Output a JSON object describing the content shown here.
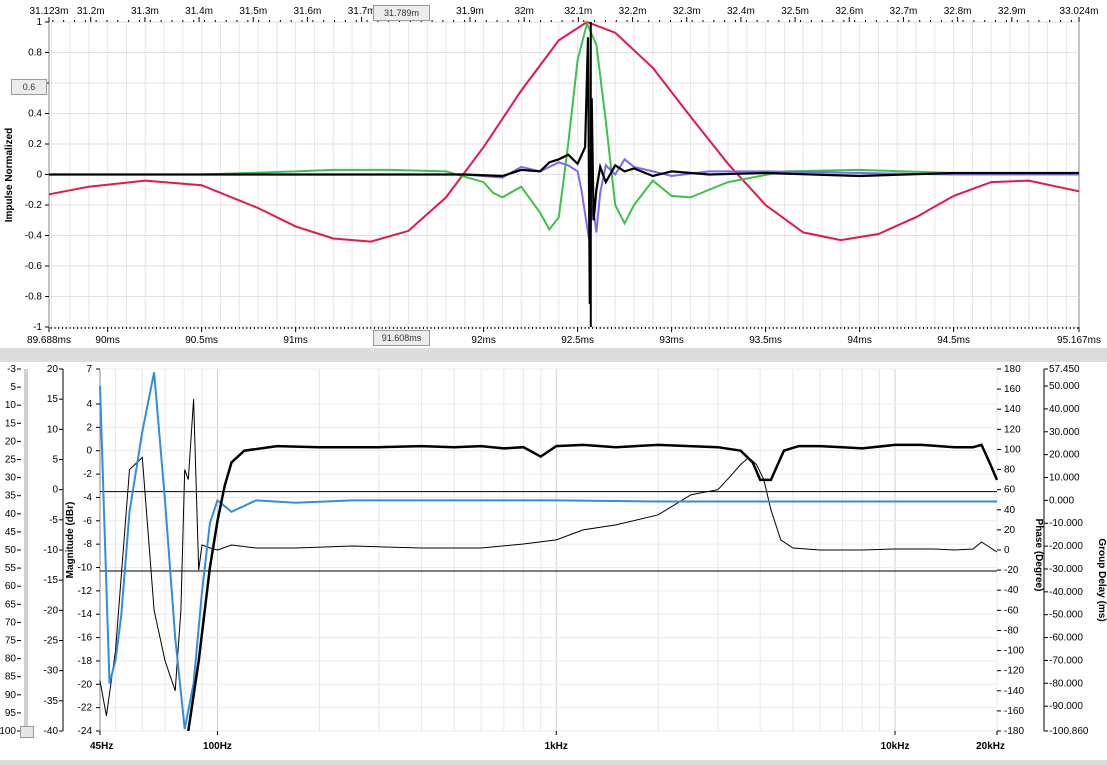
{
  "chart_data": [
    {
      "type": "line",
      "ylabel": "Impulse Normalized",
      "top_axis_ticks": [
        "31.123m",
        "31.2m",
        "31.3m",
        "31.4m",
        "31.5m",
        "31.6m",
        "31.7m",
        "31.9m",
        "32m",
        "32.1m",
        "32.2m",
        "32.3m",
        "32.4m",
        "32.5m",
        "32.6m",
        "32.7m",
        "32.8m",
        "32.9m",
        "33.024m"
      ],
      "top_axis_values": [
        31.123,
        31.2,
        31.3,
        31.4,
        31.5,
        31.6,
        31.7,
        31.9,
        32.0,
        32.1,
        32.2,
        32.3,
        32.4,
        32.5,
        32.6,
        32.7,
        32.8,
        32.9,
        33.024
      ],
      "bottom_axis_ticks": [
        "89.688ms",
        "90ms",
        "90.5ms",
        "91ms",
        "92ms",
        "92.5ms",
        "93ms",
        "93.5ms",
        "94ms",
        "94.5ms",
        "95.167ms"
      ],
      "bottom_axis_values": [
        89.688,
        90.0,
        90.5,
        91.0,
        92.0,
        92.5,
        93.0,
        93.5,
        94.0,
        94.5,
        95.167
      ],
      "y_ticks": [
        "1",
        "0.8",
        "0.6",
        "0.4",
        "0.2",
        "0",
        "-0.2",
        "-0.4",
        "-0.6",
        "-0.8",
        "-1"
      ],
      "y_tick_values": [
        1,
        0.8,
        0.6,
        0.4,
        0.2,
        0,
        -0.2,
        -0.4,
        -0.6,
        -0.8,
        -1
      ],
      "xlim": [
        89.688,
        95.167
      ],
      "ylim": [
        -1,
        1
      ],
      "grid": true,
      "cursor_top_label": "31.789m",
      "cursor_bottom_label": "91.608ms",
      "cursor_y_label": "0.6",
      "impulse_peak_x": 92.57,
      "series": [
        {
          "color": "#e8164a",
          "x": [
            89.688,
            89.9,
            90.2,
            90.5,
            90.8,
            91.0,
            91.2,
            91.4,
            91.6,
            91.8,
            92.0,
            92.2,
            92.4,
            92.55,
            92.7,
            92.9,
            93.1,
            93.3,
            93.5,
            93.7,
            93.9,
            94.1,
            94.3,
            94.5,
            94.7,
            94.9,
            95.167
          ],
          "values": [
            -0.13,
            -0.08,
            -0.04,
            -0.07,
            -0.22,
            -0.34,
            -0.42,
            -0.44,
            -0.37,
            -0.15,
            0.18,
            0.55,
            0.88,
            1.0,
            0.93,
            0.7,
            0.38,
            0.07,
            -0.2,
            -0.38,
            -0.43,
            -0.39,
            -0.28,
            -0.14,
            -0.05,
            -0.04,
            -0.11
          ]
        },
        {
          "color": "#3ec24a",
          "x": [
            89.688,
            90.5,
            91.0,
            91.2,
            91.5,
            91.8,
            92.0,
            92.05,
            92.1,
            92.2,
            92.3,
            92.35,
            92.4,
            92.45,
            92.5,
            92.55,
            92.6,
            92.65,
            92.7,
            92.75,
            92.8,
            92.9,
            93.0,
            93.1,
            93.3,
            93.6,
            94.0,
            94.5,
            95.167
          ],
          "values": [
            0.0,
            0.0,
            0.02,
            0.03,
            0.03,
            0.02,
            -0.05,
            -0.12,
            -0.15,
            -0.08,
            -0.25,
            -0.36,
            -0.28,
            0.2,
            0.75,
            0.99,
            0.85,
            0.35,
            -0.2,
            -0.32,
            -0.2,
            -0.04,
            -0.14,
            -0.15,
            -0.05,
            0.02,
            0.03,
            0.01,
            0.0
          ]
        },
        {
          "color": "#7a6cf0",
          "x": [
            89.688,
            90.5,
            91.0,
            91.5,
            91.9,
            92.1,
            92.2,
            92.3,
            92.4,
            92.45,
            92.5,
            92.52,
            92.56,
            92.58,
            92.6,
            92.62,
            92.65,
            92.7,
            92.75,
            92.8,
            92.9,
            93.0,
            93.2,
            93.5,
            94.0,
            94.5,
            95.167
          ],
          "values": [
            0.0,
            0.0,
            0.0,
            0.0,
            0.0,
            -0.02,
            0.05,
            0.02,
            0.08,
            0.06,
            0.02,
            -0.1,
            -0.42,
            -0.2,
            -0.38,
            -0.12,
            0.06,
            0.0,
            0.1,
            0.05,
            0.02,
            -0.01,
            0.02,
            0.02,
            0.01,
            0.0,
            0.0
          ]
        },
        {
          "color": "#000000",
          "x": [
            89.688,
            90.5,
            91.0,
            91.5,
            91.9,
            92.1,
            92.2,
            92.3,
            92.35,
            92.4,
            92.45,
            92.5,
            92.54,
            92.555,
            92.565,
            92.575,
            92.585,
            92.6,
            92.62,
            92.65,
            92.7,
            92.75,
            92.8,
            92.9,
            93.0,
            93.2,
            93.5,
            94.0,
            94.5,
            95.167
          ],
          "values": [
            0.0,
            0.0,
            0.0,
            0.0,
            0.0,
            -0.01,
            0.03,
            0.02,
            0.08,
            0.1,
            0.13,
            0.07,
            0.18,
            0.9,
            -0.85,
            0.5,
            -0.3,
            -0.1,
            0.05,
            -0.05,
            0.06,
            0.02,
            0.04,
            -0.01,
            0.02,
            0.0,
            0.01,
            -0.01,
            0.01,
            0.01
          ]
        }
      ]
    },
    {
      "type": "line",
      "xlabel": "",
      "x_scale": "log",
      "ylabel": "Magnitude (dBr)",
      "ylabel_right": "Phase (Degree)",
      "ylabel_right2": "Group Delay (ms)",
      "x_ticks": [
        "45Hz",
        "100Hz",
        "1kHz",
        "10kHz",
        "20kHz"
      ],
      "x_tick_values": [
        45,
        100,
        1000,
        10000,
        20000
      ],
      "xlim": [
        45,
        20000
      ],
      "mag_ticks": [
        "7",
        "4",
        "2",
        "0",
        "-2",
        "-4",
        "-6",
        "-8",
        "-10",
        "-12",
        "-14",
        "-16",
        "-18",
        "-20",
        "-22",
        "-24"
      ],
      "mag_tick_values": [
        7,
        4,
        2,
        0,
        -2,
        -4,
        -6,
        -8,
        -10,
        -12,
        -14,
        -16,
        -18,
        -20,
        -22,
        -24
      ],
      "mag_ylim": [
        -24,
        7
      ],
      "outer_left_ticks": [
        "-3",
        "5",
        "10",
        "15",
        "20",
        "25",
        "30",
        "35",
        "40",
        "45",
        "50",
        "55",
        "60",
        "65",
        "70",
        "75",
        "80",
        "85",
        "90",
        "95",
        "100"
      ],
      "inner_left_ticks": [
        "20",
        "15",
        "10",
        "5",
        "0",
        "-5",
        "-10",
        "-15",
        "-20",
        "-25",
        "-30",
        "-35",
        "-40"
      ],
      "phase_ticks": [
        "180",
        "160",
        "140",
        "120",
        "100",
        "80",
        "60",
        "40",
        "20",
        "0",
        "-20",
        "-40",
        "-60",
        "-80",
        "-100",
        "-120",
        "-140",
        "-160",
        "-180"
      ],
      "phase_tick_values": [
        180,
        160,
        140,
        120,
        100,
        80,
        60,
        40,
        20,
        0,
        -20,
        -40,
        -60,
        -80,
        -100,
        -120,
        -140,
        -160,
        -180
      ],
      "phase_ylim": [
        -180,
        180
      ],
      "gd_ticks": [
        "57.450",
        "50.000",
        "40.000",
        "30.000",
        "20.000",
        "10.000",
        "0.000",
        "-10.000",
        "-20.000",
        "-30.000",
        "-40.000",
        "-50.000",
        "-60.000",
        "-70.000",
        "-80.000",
        "-90.000",
        "-100.860"
      ],
      "gd_tick_values": [
        57.45,
        50,
        40,
        30,
        20,
        10,
        0,
        -10,
        -20,
        -30,
        -40,
        -50,
        -60,
        -70,
        -80,
        -90,
        -100.86
      ],
      "gd_ylim": [
        -100.86,
        57.45
      ],
      "marker_lines_mag": [
        -3.5,
        -10.3
      ],
      "grid": true,
      "magnitude_series": {
        "color": "#000000",
        "x": [
          82,
          88,
          95,
          100,
          105,
          110,
          120,
          150,
          200,
          300,
          400,
          500,
          600,
          700,
          800,
          900,
          1000,
          1200,
          1500,
          2000,
          3000,
          3500,
          3800,
          4000,
          4300,
          4700,
          5200,
          6000,
          7000,
          8000,
          10000,
          12000,
          15000,
          17000,
          18000,
          19000,
          20000
        ],
        "values": [
          -24,
          -18,
          -10,
          -6,
          -3,
          -1,
          0,
          0.4,
          0.3,
          0.3,
          0.4,
          0.3,
          0.4,
          0.2,
          0.3,
          -0.5,
          0.4,
          0.5,
          0.3,
          0.5,
          0.3,
          0.0,
          -1.0,
          -2.5,
          -2.5,
          0.0,
          0.4,
          0.4,
          0.3,
          0.2,
          0.5,
          0.5,
          0.3,
          0.3,
          0.5,
          -1.0,
          -2.5
        ]
      },
      "phase_series": {
        "color": "#000000",
        "x": [
          45,
          47,
          50,
          55,
          60,
          65,
          70,
          75,
          78,
          80,
          82,
          85,
          88,
          90,
          95,
          100,
          110,
          130,
          170,
          250,
          400,
          600,
          800,
          1000,
          1200,
          1500,
          2000,
          2500,
          3000,
          3300,
          3500,
          3700,
          3900,
          4100,
          4300,
          4600,
          5000,
          6000,
          8000,
          10000,
          13000,
          15000,
          17000,
          18000,
          20000
        ],
        "values": [
          -130,
          -165,
          -100,
          80,
          92,
          -60,
          -110,
          -140,
          -60,
          80,
          70,
          150,
          -20,
          5,
          2,
          0,
          5,
          2,
          2,
          4,
          2,
          2,
          6,
          10,
          20,
          25,
          35,
          55,
          60,
          75,
          85,
          92,
          85,
          70,
          40,
          10,
          2,
          0,
          0,
          1,
          1,
          0,
          1,
          8,
          -2
        ]
      },
      "group_delay_series": {
        "color": "#2f8ee0",
        "x": [
          45,
          48,
          50,
          52,
          55,
          60,
          65,
          70,
          75,
          80,
          85,
          90,
          95,
          100,
          110,
          130,
          170,
          250,
          500,
          1000,
          2000,
          5000,
          10000,
          20000
        ],
        "values": [
          50,
          -80,
          -70,
          -50,
          -5,
          30,
          56,
          0,
          -60,
          -100,
          -80,
          -40,
          -10,
          0,
          -5,
          0,
          -1,
          0,
          0,
          0,
          -0.5,
          -0.5,
          -0.5,
          -0.5
        ]
      }
    }
  ]
}
